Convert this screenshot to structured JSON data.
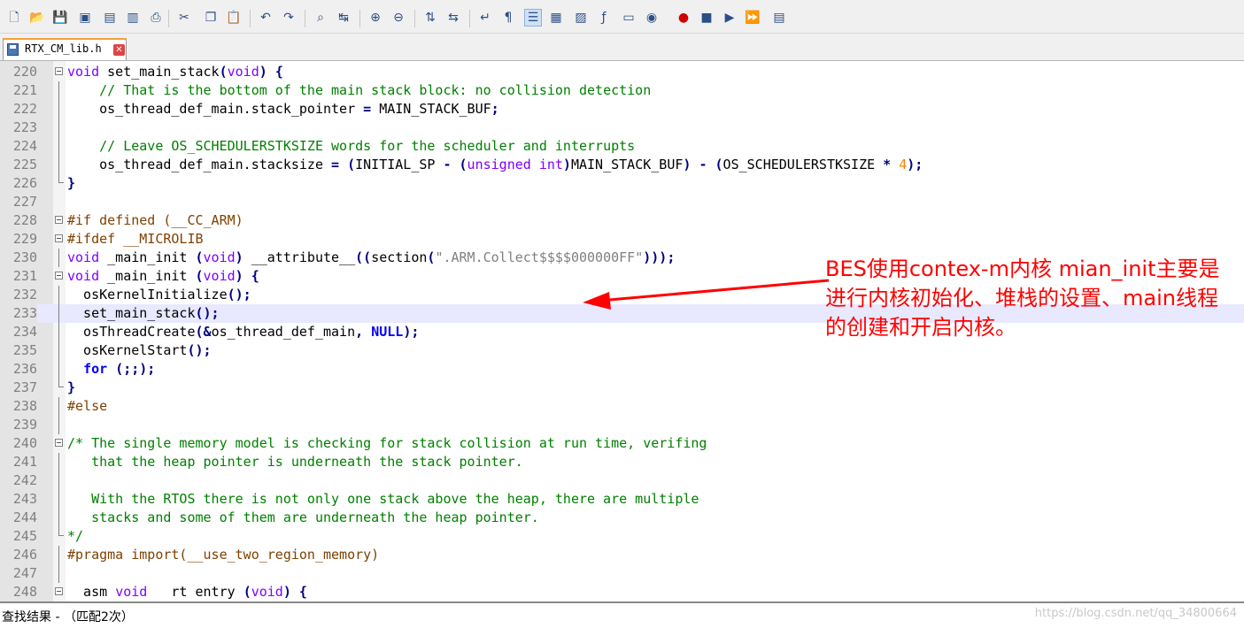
{
  "tab": {
    "filename": "RTX_CM_lib.h",
    "close_glyph": "✕"
  },
  "toolbar": {
    "icons": [
      {
        "name": "new-file-icon",
        "glyph": "🗋"
      },
      {
        "name": "open-file-icon",
        "glyph": "📂"
      },
      {
        "name": "save-icon",
        "glyph": "💾"
      },
      {
        "name": "save-all-icon",
        "glyph": "▣"
      },
      {
        "name": "close-icon",
        "glyph": "▤"
      },
      {
        "name": "close-all-icon",
        "glyph": "▥"
      },
      {
        "name": "print-icon",
        "glyph": "⎙"
      },
      {
        "name": "cut-icon",
        "glyph": "✂"
      },
      {
        "name": "copy-icon",
        "glyph": "❐"
      },
      {
        "name": "paste-icon",
        "glyph": "📋"
      },
      {
        "name": "undo-icon",
        "glyph": "↶"
      },
      {
        "name": "redo-icon",
        "glyph": "↷"
      },
      {
        "name": "find-icon",
        "glyph": "⌕"
      },
      {
        "name": "replace-icon",
        "glyph": "↹"
      },
      {
        "name": "zoom-in-icon",
        "glyph": "⊕"
      },
      {
        "name": "zoom-out-icon",
        "glyph": "⊖"
      },
      {
        "name": "sync-v-icon",
        "glyph": "⇅"
      },
      {
        "name": "sync-h-icon",
        "glyph": "⇆"
      },
      {
        "name": "word-wrap-icon",
        "glyph": "↵"
      },
      {
        "name": "show-all-chars-icon",
        "glyph": "¶"
      },
      {
        "name": "indent-guide-icon",
        "glyph": "☰"
      },
      {
        "name": "user-lang-icon",
        "glyph": "▦"
      },
      {
        "name": "doc-map-icon",
        "glyph": "▨"
      },
      {
        "name": "function-list-icon",
        "glyph": "ƒ"
      },
      {
        "name": "folder-workspace-icon",
        "glyph": "▭"
      },
      {
        "name": "monitoring-icon",
        "glyph": "◉"
      },
      {
        "name": "record-macro-icon",
        "glyph": "●"
      },
      {
        "name": "stop-record-icon",
        "glyph": "■"
      },
      {
        "name": "play-macro-icon",
        "glyph": "▶"
      },
      {
        "name": "run-multiple-icon",
        "glyph": "⏩"
      },
      {
        "name": "save-macro-icon",
        "glyph": "▤"
      }
    ]
  },
  "editor": {
    "lines": [
      {
        "n": "220",
        "html": "<span class=\"kw\">void</span> set_main_stack<span class=\"op\">(</span><span class=\"kw\">void</span><span class=\"op\">)</span> <span class=\"op\">{</span>"
      },
      {
        "n": "221",
        "html": "    <span class=\"cm\">// That is the bottom of the main stack block: no collision detection</span>"
      },
      {
        "n": "222",
        "html": "    os_thread_def_main.stack_pointer <span class=\"op\">=</span> MAIN_STACK_BUF<span class=\"op\">;</span>"
      },
      {
        "n": "223",
        "html": ""
      },
      {
        "n": "224",
        "html": "    <span class=\"cm\">// Leave OS_SCHEDULERSTKSIZE words for the scheduler and interrupts</span>"
      },
      {
        "n": "225",
        "html": "    os_thread_def_main.stacksize <span class=\"op\">=</span> <span class=\"op\">(</span>INITIAL_SP <span class=\"op\">-</span> <span class=\"op\">(</span><span class=\"kw\">unsigned int</span><span class=\"op\">)</span>MAIN_STACK_BUF<span class=\"op\">)</span> <span class=\"op\">-</span> <span class=\"op\">(</span>OS_SCHEDULERSTKSIZE <span class=\"op\">*</span> <span class=\"num\">4</span><span class=\"op\">);</span>"
      },
      {
        "n": "226",
        "html": "<span class=\"op\">}</span>"
      },
      {
        "n": "227",
        "html": ""
      },
      {
        "n": "228",
        "html": "<span class=\"pp\">#if defined (__CC_ARM)</span>"
      },
      {
        "n": "229",
        "html": "<span class=\"pp\">#ifdef __MICROLIB</span>"
      },
      {
        "n": "230",
        "html": "<span class=\"kw\">void</span> _main_init <span class=\"op\">(</span><span class=\"kw\">void</span><span class=\"op\">)</span> __attribute__<span class=\"op\">((</span>section<span class=\"op\">(</span><span class=\"str\">\".ARM.Collect$$$$000000FF\"</span><span class=\"op\">)));</span>"
      },
      {
        "n": "231",
        "html": "<span class=\"kw\">void</span> _main_init <span class=\"op\">(</span><span class=\"kw\">void</span><span class=\"op\">)</span> <span class=\"op\">{</span>"
      },
      {
        "n": "232",
        "html": "  osKernelInitialize<span class=\"op\">();</span>"
      },
      {
        "n": "233",
        "html": "  set_main_stack<span class=\"op\">();</span>"
      },
      {
        "n": "234",
        "html": "  osThreadCreate<span class=\"op\">(&amp;</span>os_thread_def_main<span class=\"op\">,</span> <span class=\"kb\">NULL</span><span class=\"op\">);</span>"
      },
      {
        "n": "235",
        "html": "  osKernelStart<span class=\"op\">();</span>"
      },
      {
        "n": "236",
        "html": "  <span class=\"kb\">for</span> <span class=\"op\">(;;);</span>"
      },
      {
        "n": "237",
        "html": "<span class=\"op\">}</span>"
      },
      {
        "n": "238",
        "html": "<span class=\"pp\">#else</span>"
      },
      {
        "n": "239",
        "html": ""
      },
      {
        "n": "240",
        "html": "<span class=\"cm\">/* The single memory model is checking for stack collision at run time, verifing</span>"
      },
      {
        "n": "241",
        "html": "<span class=\"cm\">   that the heap pointer is underneath the stack pointer.</span>"
      },
      {
        "n": "242",
        "html": ""
      },
      {
        "n": "243",
        "html": "<span class=\"cm\">   With the RTOS there is not only one stack above the heap, there are multiple</span>"
      },
      {
        "n": "244",
        "html": "<span class=\"cm\">   stacks and some of them are underneath the heap pointer.</span>"
      },
      {
        "n": "245",
        "html": "<span class=\"cm\">*/</span>"
      },
      {
        "n": "246",
        "html": "<span class=\"pp\">#pragma import(__use_two_region_memory)</span>"
      },
      {
        "n": "247",
        "html": ""
      },
      {
        "n": "248",
        "html": "  asm <span class=\"kw\">void</span>   rt entry <span class=\"op\">(</span><span class=\"kw\">void</span><span class=\"op\">)</span> <span class=\"op\">{</span>"
      }
    ]
  },
  "annotation": {
    "lines": [
      "BES使用contex-m内核 mian_init主要是",
      "进行内核初始化、堆栈的设置、main线程",
      "的创建和开启内核。"
    ],
    "color": "#ff0000"
  },
  "find_results": {
    "label": "查找结果 - （匹配2次）"
  },
  "watermark": "https://blog.csdn.net/qq_34800664"
}
